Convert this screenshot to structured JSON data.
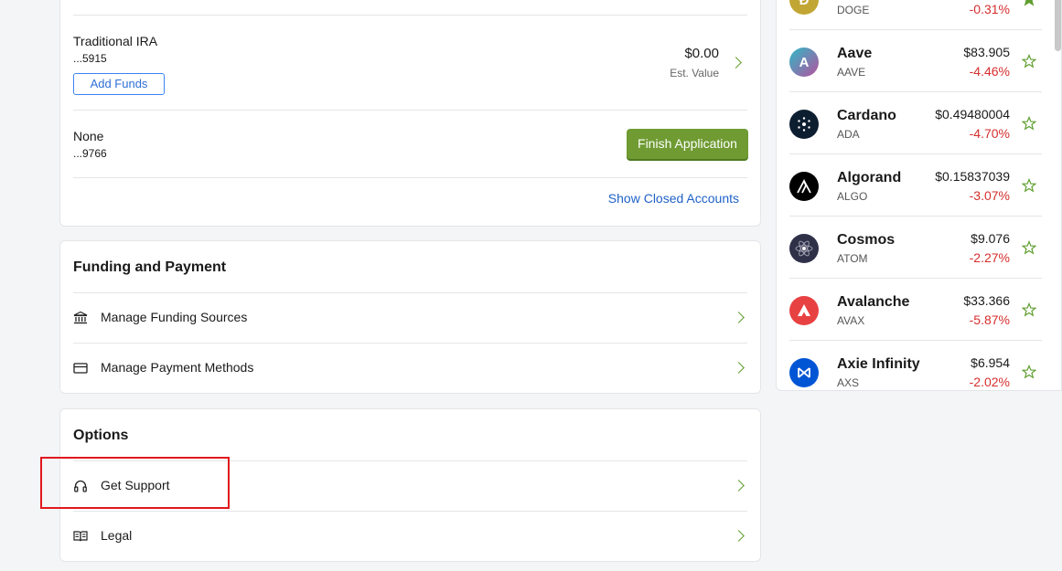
{
  "accounts": [
    {
      "name": "Traditional IRA",
      "number": "...5915",
      "value": "$0.00",
      "value_caption": "Est. Value",
      "action_label": "Add Funds"
    },
    {
      "name": "None",
      "number": "...9766",
      "action_label": "Finish Application"
    }
  ],
  "show_closed_label": "Show Closed Accounts",
  "funding": {
    "title": "Funding and Payment",
    "items": [
      {
        "label": "Manage Funding Sources",
        "icon": "bank-icon"
      },
      {
        "label": "Manage Payment Methods",
        "icon": "credit-card-icon"
      }
    ]
  },
  "options": {
    "title": "Options",
    "items": [
      {
        "label": "Get Support",
        "icon": "headphones-icon"
      },
      {
        "label": "Legal",
        "icon": "book-icon"
      }
    ]
  },
  "crypto": [
    {
      "name": "",
      "symbol": "DOGE",
      "price": "",
      "change": "-0.31%",
      "logo_color": "#c2a633",
      "favorited": true
    },
    {
      "name": "Aave",
      "symbol": "AAVE",
      "price": "$83.905",
      "change": "-4.46%",
      "logo_color": "#7a4fb5"
    },
    {
      "name": "Cardano",
      "symbol": "ADA",
      "price": "$0.49480004",
      "change": "-4.70%",
      "logo_color": "#0d1e30"
    },
    {
      "name": "Algorand",
      "symbol": "ALGO",
      "price": "$0.15837039",
      "change": "-3.07%",
      "logo_color": "#000000"
    },
    {
      "name": "Cosmos",
      "symbol": "ATOM",
      "price": "$9.076",
      "change": "-2.27%",
      "logo_color": "#2e3148"
    },
    {
      "name": "Avalanche",
      "symbol": "AVAX",
      "price": "$33.366",
      "change": "-5.87%",
      "logo_color": "#e84142"
    },
    {
      "name": "Axie Infinity",
      "symbol": "AXS",
      "price": "$6.954",
      "change": "-2.02%",
      "logo_color": "#0055d5"
    }
  ],
  "colors": {
    "accent_green": "#6f9b32",
    "negative_red": "#d62e2e",
    "link_blue": "#1f62c8",
    "highlight_red": "#e0181e"
  }
}
